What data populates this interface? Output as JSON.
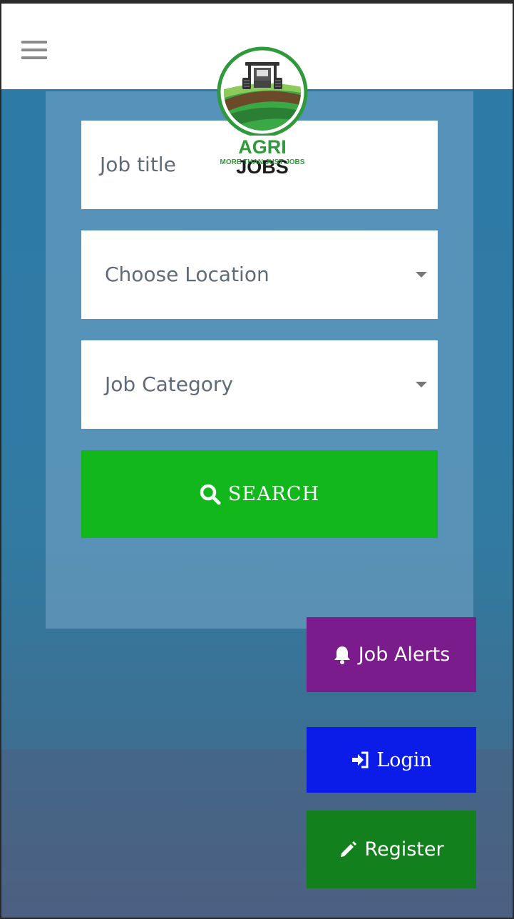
{
  "header": {
    "menu_icon": "hamburger-menu-icon",
    "logo": {
      "brand_part1": "AGRI",
      "brand_part2": "JOBS",
      "tagline": "MORE THAN JUST JOBS"
    }
  },
  "search_form": {
    "job_title": {
      "placeholder": "Job title",
      "value": ""
    },
    "location": {
      "selected": "Choose Location"
    },
    "category": {
      "selected": "Job Category"
    },
    "search_button": {
      "label": "SEARCH",
      "icon": "search-icon"
    }
  },
  "actions": {
    "job_alerts": {
      "label": "Job Alerts",
      "icon": "bell-icon"
    },
    "login": {
      "label": "Login",
      "icon": "sign-in-icon"
    },
    "register": {
      "label": "Register",
      "icon": "pencil-icon"
    }
  },
  "colors": {
    "search": "#12b81b",
    "job_alerts": "#7a1c8c",
    "login": "#0b1be8",
    "register": "#13801e",
    "brand_green": "#2f9a3b"
  }
}
